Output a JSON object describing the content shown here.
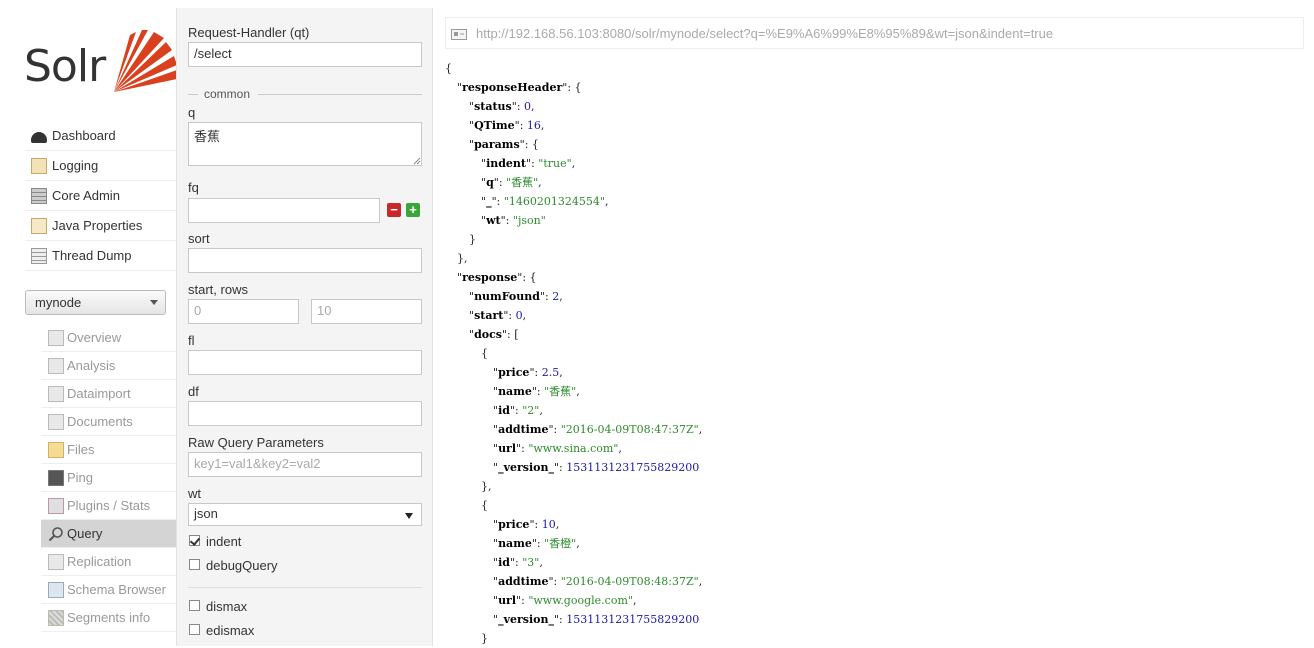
{
  "nav": {
    "logo_text": "Solr",
    "main_items": [
      {
        "label": "Dashboard",
        "icon": "dashboard-icon"
      },
      {
        "label": "Logging",
        "icon": "logging-icon"
      },
      {
        "label": "Core Admin",
        "icon": "core-admin-icon"
      },
      {
        "label": "Java Properties",
        "icon": "java-properties-icon"
      },
      {
        "label": "Thread Dump",
        "icon": "thread-dump-icon"
      }
    ],
    "core_selector": "mynode",
    "core_items": [
      {
        "label": "Overview",
        "icon": "home-icon"
      },
      {
        "label": "Analysis",
        "icon": "funnel-icon"
      },
      {
        "label": "Dataimport",
        "icon": "dataimport-icon"
      },
      {
        "label": "Documents",
        "icon": "documents-icon"
      },
      {
        "label": "Files",
        "icon": "files-icon"
      },
      {
        "label": "Ping",
        "icon": "ping-icon"
      },
      {
        "label": "Plugins / Stats",
        "icon": "plugins-icon"
      },
      {
        "label": "Query",
        "icon": "magnifier-icon"
      },
      {
        "label": "Replication",
        "icon": "replication-icon"
      },
      {
        "label": "Schema Browser",
        "icon": "schema-icon"
      },
      {
        "label": "Segments info",
        "icon": "segments-icon"
      }
    ]
  },
  "form": {
    "handler_label": "Request-Handler (qt)",
    "handler_value": "/select",
    "section_common": "common",
    "q_label": "q",
    "q_value": "香蕉",
    "fq_label": "fq",
    "fq_value": "",
    "sort_label": "sort",
    "sort_value": "",
    "start_rows_label": "start, rows",
    "start_value": "0",
    "rows_value": "10",
    "fl_label": "fl",
    "fl_value": "",
    "df_label": "df",
    "df_value": "",
    "raw_label": "Raw Query Parameters",
    "raw_placeholder": "key1=val1&key2=val2",
    "wt_label": "wt",
    "wt_value": "json",
    "indent_label": "indent",
    "indent_checked": true,
    "debug_label": "debugQuery",
    "debug_checked": false,
    "dismax_label": "dismax",
    "edismax_label": "edismax"
  },
  "result": {
    "url": "http://192.168.56.103:8080/solr/mynode/select?q=%E9%A6%99%E8%95%89&wt=json&indent=true",
    "lines": [
      {
        "p": "{",
        "t": "plain"
      },
      {
        "k": "responseHeader",
        "p": ": {",
        "t": "key"
      },
      {
        "k": "status",
        "v": "0",
        "t": "num"
      },
      {
        "k": "QTime",
        "v": "16",
        "t": "num"
      },
      {
        "k": "params",
        "p": ": {",
        "t": "key"
      },
      {
        "k": "indent",
        "v": "\"true\"",
        "t": "str"
      },
      {
        "k": "q",
        "v": "\"香蕉\"",
        "t": "str"
      },
      {
        "k": "_",
        "v": "\"1460201324554\"",
        "t": "str"
      },
      {
        "k": "wt",
        "v": "\"json\"",
        "t": "strlast"
      },
      {
        "p": "}",
        "t": "plain"
      },
      {
        "p": "},",
        "t": "plain"
      },
      {
        "k": "response",
        "p": ": {",
        "t": "key"
      },
      {
        "k": "numFound",
        "v": "2",
        "t": "num"
      },
      {
        "k": "start",
        "v": "0",
        "t": "num"
      },
      {
        "k": "docs",
        "p": ": [",
        "t": "key"
      },
      {
        "p": "{",
        "t": "plain"
      },
      {
        "k": "price",
        "v": "2.5",
        "t": "num"
      },
      {
        "k": "name",
        "v": "\"香蕉\"",
        "t": "str"
      },
      {
        "k": "id",
        "v": "\"2\"",
        "t": "str"
      },
      {
        "k": "addtime",
        "v": "\"2016-04-09T08:47:37Z\"",
        "t": "str"
      },
      {
        "k": "url",
        "v": "\"www.sina.com\"",
        "t": "str"
      },
      {
        "k": "_version_",
        "v": "1531131231755829200",
        "t": "numlast"
      },
      {
        "p": "},",
        "t": "plain"
      },
      {
        "p": "{",
        "t": "plain"
      },
      {
        "k": "price",
        "v": "10",
        "t": "num"
      },
      {
        "k": "name",
        "v": "\"香橙\"",
        "t": "str"
      },
      {
        "k": "id",
        "v": "\"3\"",
        "t": "str"
      },
      {
        "k": "addtime",
        "v": "\"2016-04-09T08:48:37Z\"",
        "t": "str"
      },
      {
        "k": "url",
        "v": "\"www.google.com\"",
        "t": "str"
      },
      {
        "k": "_version_",
        "v": "1531131231755829200",
        "t": "numlast"
      },
      {
        "p": "}",
        "t": "plain"
      }
    ]
  },
  "colors": {
    "string": "#2e8b2e",
    "number": "#1a1aa6",
    "logo_accent": "#d9411e",
    "remove_button": "#c8282a",
    "add_button": "#3aa63a"
  }
}
